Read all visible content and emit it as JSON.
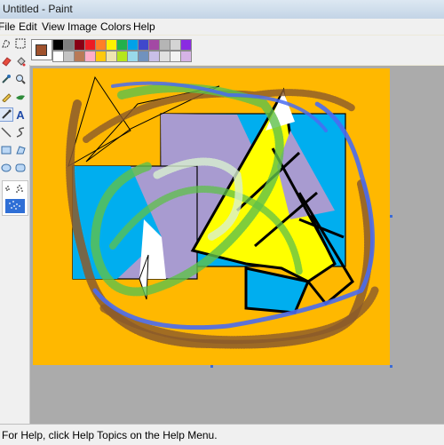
{
  "window": {
    "title": "Untitled - Paint"
  },
  "menu": [
    "File",
    "Edit",
    "View",
    "Image",
    "Colors",
    "Help"
  ],
  "toolbox": {
    "tools": [
      "free-form-select-icon",
      "select-icon",
      "eraser-icon",
      "fill-icon",
      "pick-color-icon",
      "magnifier-icon",
      "pencil-icon",
      "brush-icon",
      "airbrush-icon",
      "text-icon",
      "line-icon",
      "curve-icon",
      "rectangle-icon",
      "polygon-icon",
      "ellipse-icon",
      "rounded-rectangle-icon"
    ],
    "active_tool": "airbrush-icon",
    "text_tool_glyph": "A"
  },
  "palette": {
    "foreground": "#a0522d",
    "background": "#ffffff",
    "colors_row1": [
      "#000000",
      "#7f7f7f",
      "#880015",
      "#ed1c24",
      "#ff7f27",
      "#fff200",
      "#22b14c",
      "#00a2e8",
      "#3f48cc",
      "#a349a4",
      "#b5b5b5",
      "#d4d4d4",
      "#8a2be2"
    ],
    "colors_row2": [
      "#ffffff",
      "#c3c3c3",
      "#b97a57",
      "#ffaec9",
      "#ffc90e",
      "#efe4b0",
      "#b5e61d",
      "#99d9ea",
      "#7092be",
      "#c8bfe7",
      "#e0e0e0",
      "#f2f2f2",
      "#d6b3e6"
    ]
  },
  "canvas": {
    "background": "#ffb800",
    "shapes": {
      "rect_outline": "#000000",
      "cyan": "#00aeef",
      "lavender": "#a89bd0",
      "yellow": "#ffff00",
      "white": "#ffffff",
      "spray_blue": "#4a6cf0",
      "spray_brown": "#8b5a2b",
      "spray_green": "#5fc04a"
    }
  },
  "status": {
    "text": "For Help, click Help Topics on the Help Menu."
  }
}
